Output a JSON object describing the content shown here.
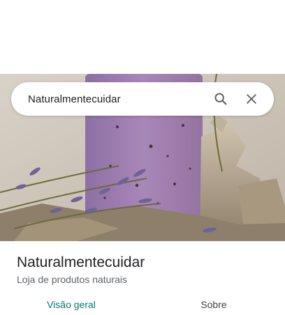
{
  "search": {
    "query": "Naturalmentecuidar",
    "search_icon": "search-icon",
    "close_icon": "close-icon"
  },
  "hero_image": {
    "description_icon": "product-photo"
  },
  "place": {
    "name": "Naturalmentecuidar",
    "category": "Loja de produtos naturais"
  },
  "tabs": [
    {
      "label": "Visão geral",
      "active": true
    },
    {
      "label": "Sobre",
      "active": false
    }
  ],
  "colors": {
    "accent": "#00796b",
    "text_primary": "#202124",
    "text_secondary": "#5f6368"
  }
}
